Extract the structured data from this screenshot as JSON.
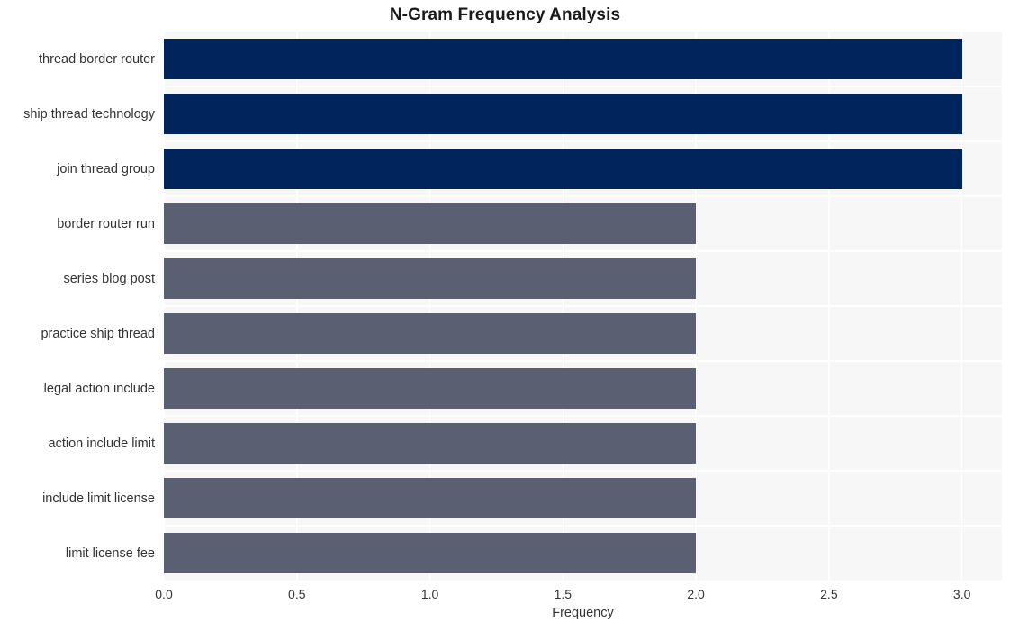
{
  "chart_data": {
    "type": "bar",
    "orientation": "horizontal",
    "title": "N-Gram Frequency Analysis",
    "xlabel": "Frequency",
    "ylabel": "",
    "categories": [
      "thread border router",
      "ship thread technology",
      "join thread group",
      "border router run",
      "series blog post",
      "practice ship thread",
      "legal action include",
      "action include limit",
      "include limit license",
      "limit license fee"
    ],
    "values": [
      3,
      3,
      3,
      2,
      2,
      2,
      2,
      2,
      2,
      2
    ],
    "bar_colors": [
      "#00245c",
      "#00245c",
      "#00245c",
      "#5a6072",
      "#5a6072",
      "#5a6072",
      "#5a6072",
      "#5a6072",
      "#5a6072",
      "#5a6072"
    ],
    "xlim": [
      0.0,
      3.15
    ],
    "xticks": [
      0.0,
      0.5,
      1.0,
      1.5,
      2.0,
      2.5,
      3.0
    ],
    "xtick_labels": [
      "0.0",
      "0.5",
      "1.0",
      "1.5",
      "2.0",
      "2.5",
      "3.0"
    ],
    "grid": true,
    "grid_color": "#ffffff",
    "plot_background": "#f7f7f7",
    "figure_background": "#ffffff",
    "legend": null
  },
  "colors": {
    "accent_primary": "#00245c",
    "accent_secondary": "#5a6072",
    "text": "#333333",
    "title": "#1a1a1a"
  }
}
